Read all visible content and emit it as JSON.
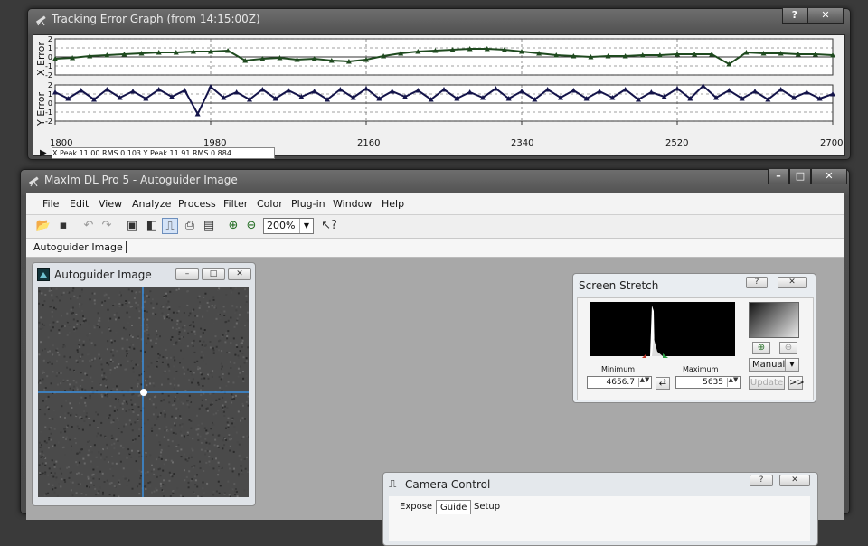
{
  "tracking": {
    "title": "Tracking Error Graph (from 14:15:00Z)",
    "help_label": "?",
    "close_label": "✕",
    "x_axis_label": "X Error",
    "y_axis_label": "Y Error",
    "y_ticks_x": [
      "2",
      "1",
      "0",
      "-1",
      "-2"
    ],
    "y_ticks_y": [
      "2",
      "1",
      "0",
      "-1",
      "-2"
    ],
    "x_ticks": [
      "1800",
      "1980",
      "2160",
      "2340",
      "2520",
      "2700"
    ],
    "status": "X Peak 11.00  RMS 0.103     Y Peak 11.91  RMS 0.884"
  },
  "maxim": {
    "title": "MaxIm DL Pro 5 - Autoguider Image",
    "minimize_label": "–",
    "maximize_label": "□",
    "close_label": "✕",
    "menu": [
      "File",
      "Edit",
      "View",
      "Analyze",
      "Process",
      "Filter",
      "Color",
      "Plug-in",
      "Window",
      "Help"
    ],
    "toolbar_icons": [
      "open-icon",
      "save-icon",
      "undo-icon",
      "redo-icon",
      "image-view-icon",
      "screen-stretch-icon",
      "camera-control-icon",
      "toolbox-icon",
      "properties-icon",
      "zoom-in-icon",
      "zoom-out-icon",
      "context-help-icon"
    ],
    "zoom_value": "200%",
    "doc_tab": "Autoguider Image"
  },
  "autoguider": {
    "title": "Autoguider Image",
    "minimize_label": "–",
    "restore_label": "□",
    "close_label": "✕",
    "crosshair_color": "#3a8fe0"
  },
  "screen_stretch": {
    "title": "Screen Stretch",
    "help_label": "?",
    "close_label": "✕",
    "minimum_label": "Minimum",
    "maximum_label": "Maximum",
    "minimum_value": "4656.7",
    "maximum_value": "5635",
    "mode": "Manual",
    "update_label": "Update",
    "more_label": ">>"
  },
  "camera_control": {
    "title": "Camera Control",
    "help_label": "?",
    "close_label": "✕",
    "tabs": [
      "Expose",
      "Guide",
      "Setup"
    ]
  },
  "chart_data": [
    {
      "type": "scatter",
      "ylabel": "X Error",
      "x_range": [
        1800,
        2700
      ],
      "ylim": [
        -2,
        2
      ],
      "grid": true,
      "series": [
        {
          "color": "#1f4a1f",
          "x": [
            1800,
            1820,
            1840,
            1860,
            1880,
            1900,
            1920,
            1940,
            1960,
            1980,
            2000,
            2020,
            2040,
            2060,
            2080,
            2100,
            2120,
            2140,
            2160,
            2180,
            2200,
            2220,
            2240,
            2260,
            2280,
            2300,
            2320,
            2340,
            2360,
            2380,
            2400,
            2420,
            2440,
            2460,
            2480,
            2500,
            2520,
            2540,
            2560,
            2580,
            2600,
            2620,
            2640,
            2660,
            2680,
            2700
          ],
          "y": [
            -0.2,
            -0.1,
            0.1,
            0.2,
            0.3,
            0.4,
            0.5,
            0.5,
            0.6,
            0.6,
            0.7,
            -0.4,
            -0.2,
            -0.1,
            -0.3,
            -0.2,
            -0.4,
            -0.5,
            -0.3,
            0.1,
            0.4,
            0.6,
            0.7,
            0.8,
            0.9,
            0.9,
            0.8,
            0.6,
            0.4,
            0.2,
            0.1,
            0.0,
            0.1,
            0.1,
            0.2,
            0.2,
            0.3,
            0.3,
            0.3,
            -0.8,
            0.5,
            0.4,
            0.4,
            0.3,
            0.3,
            0.2
          ]
        }
      ]
    },
    {
      "type": "scatter",
      "ylabel": "Y Error",
      "x_range": [
        1800,
        2700
      ],
      "ylim": [
        -2,
        2
      ],
      "grid": true,
      "series": [
        {
          "color": "#14144a",
          "x": [
            1800,
            1815,
            1830,
            1845,
            1860,
            1875,
            1890,
            1905,
            1920,
            1935,
            1950,
            1965,
            1980,
            1995,
            2010,
            2025,
            2040,
            2055,
            2070,
            2085,
            2100,
            2115,
            2130,
            2145,
            2160,
            2175,
            2190,
            2205,
            2220,
            2235,
            2250,
            2265,
            2280,
            2295,
            2310,
            2325,
            2340,
            2355,
            2370,
            2385,
            2400,
            2415,
            2430,
            2445,
            2460,
            2475,
            2490,
            2505,
            2520,
            2535,
            2550,
            2565,
            2580,
            2595,
            2610,
            2625,
            2640,
            2655,
            2670,
            2685,
            2700
          ],
          "y": [
            1.2,
            0.5,
            1.4,
            0.4,
            1.5,
            0.6,
            1.3,
            0.5,
            1.5,
            0.7,
            1.4,
            -1.2,
            1.8,
            0.6,
            1.2,
            0.4,
            1.5,
            0.5,
            1.4,
            0.7,
            1.3,
            0.4,
            1.5,
            0.6,
            1.6,
            0.5,
            1.3,
            0.7,
            1.4,
            0.4,
            1.5,
            0.5,
            1.2,
            0.6,
            1.6,
            0.5,
            1.3,
            0.4,
            1.5,
            0.6,
            1.4,
            0.5,
            1.3,
            0.6,
            1.5,
            0.4,
            1.2,
            0.7,
            1.6,
            0.5,
            1.9,
            0.6,
            1.4,
            0.5,
            1.3,
            0.4,
            1.5,
            0.6,
            1.2,
            0.5,
            1.0
          ]
        }
      ]
    }
  ]
}
